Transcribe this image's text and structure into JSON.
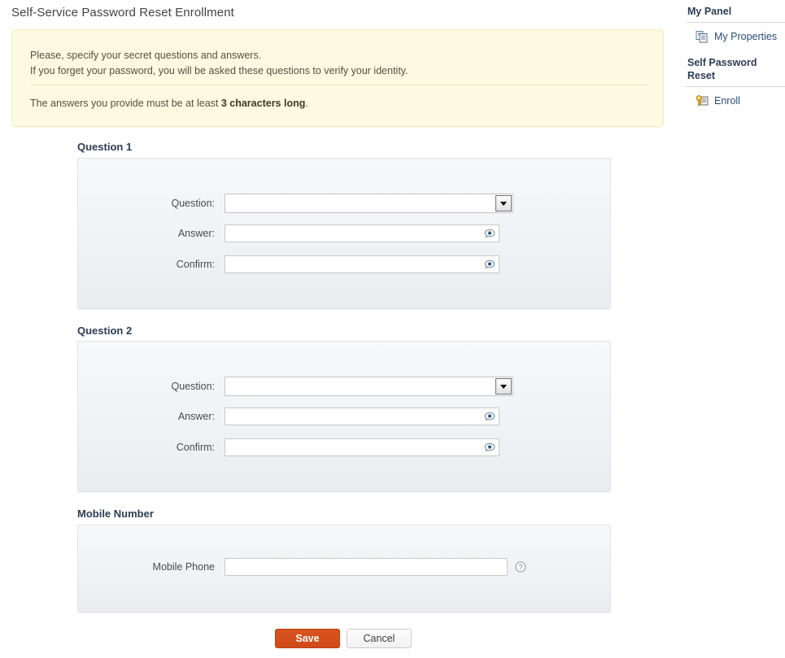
{
  "page": {
    "title": "Self-Service Password Reset Enrollment"
  },
  "notice": {
    "line1": "Please, specify your secret questions and answers.",
    "line2": "If you forget your password, you will be asked these questions to verify your identity.",
    "line3_prefix": "The answers you provide must be at least ",
    "line3_bold": "3 characters long",
    "line3_suffix": "."
  },
  "side_panel": {
    "heading1": "My Panel",
    "item1": {
      "label": "My Properties",
      "icon": "copy-pages-icon"
    },
    "heading2": "Self Password Reset",
    "item2": {
      "label": "Enroll",
      "icon": "key-form-icon"
    }
  },
  "sections": {
    "question1": {
      "title": "Question 1",
      "question": {
        "label": "Question:",
        "value": "",
        "icon": "chevron-down-icon"
      },
      "answer": {
        "label": "Answer:",
        "value": "",
        "placeholder": "",
        "icon": "eye-reveal-icon"
      },
      "confirm": {
        "label": "Confirm:",
        "value": "",
        "placeholder": "",
        "icon": "eye-reveal-icon"
      }
    },
    "question2": {
      "title": "Question 2",
      "question": {
        "label": "Question:",
        "value": "",
        "icon": "chevron-down-icon"
      },
      "answer": {
        "label": "Answer:",
        "value": "",
        "placeholder": "",
        "icon": "eye-reveal-icon"
      },
      "confirm": {
        "label": "Confirm:",
        "value": "",
        "placeholder": "",
        "icon": "eye-reveal-icon"
      }
    },
    "mobile": {
      "title": "Mobile Number",
      "phone": {
        "label": "Mobile Phone",
        "value": "",
        "placeholder": "",
        "icon": "help-circle-icon"
      }
    }
  },
  "buttons": {
    "save": "Save",
    "cancel": "Cancel"
  },
  "colors": {
    "accent": "#cf4a17",
    "notice_bg": "#fcfae0",
    "notice_border": "#f2eec0",
    "panel_bg": "#f1f2f5",
    "heading": "#2d3c52",
    "link": "#2a4b7c"
  }
}
